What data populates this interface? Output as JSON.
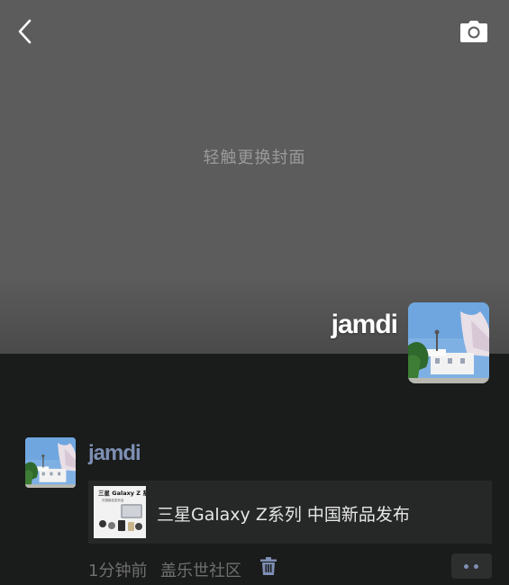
{
  "cover": {
    "hint": "轻触更换封面",
    "bg_color": "#5c5c5c"
  },
  "header": {
    "back_icon": "chevron-left-icon",
    "camera_icon": "camera-icon"
  },
  "profile": {
    "name": "jamdi",
    "avatar_icon": "avatar-photo"
  },
  "post": {
    "author": "jamdi",
    "author_color": "#7d8fb3",
    "link": {
      "title": "三星Galaxy Z系列 中国新品发布",
      "thumb_heading": "三星 Galaxy Z 系列",
      "thumb_sub": "中国新品发布会"
    },
    "time": "1分钟前",
    "source": "盖乐世社区",
    "delete_icon": "trash-icon",
    "more_icon": "more-dots-icon"
  }
}
